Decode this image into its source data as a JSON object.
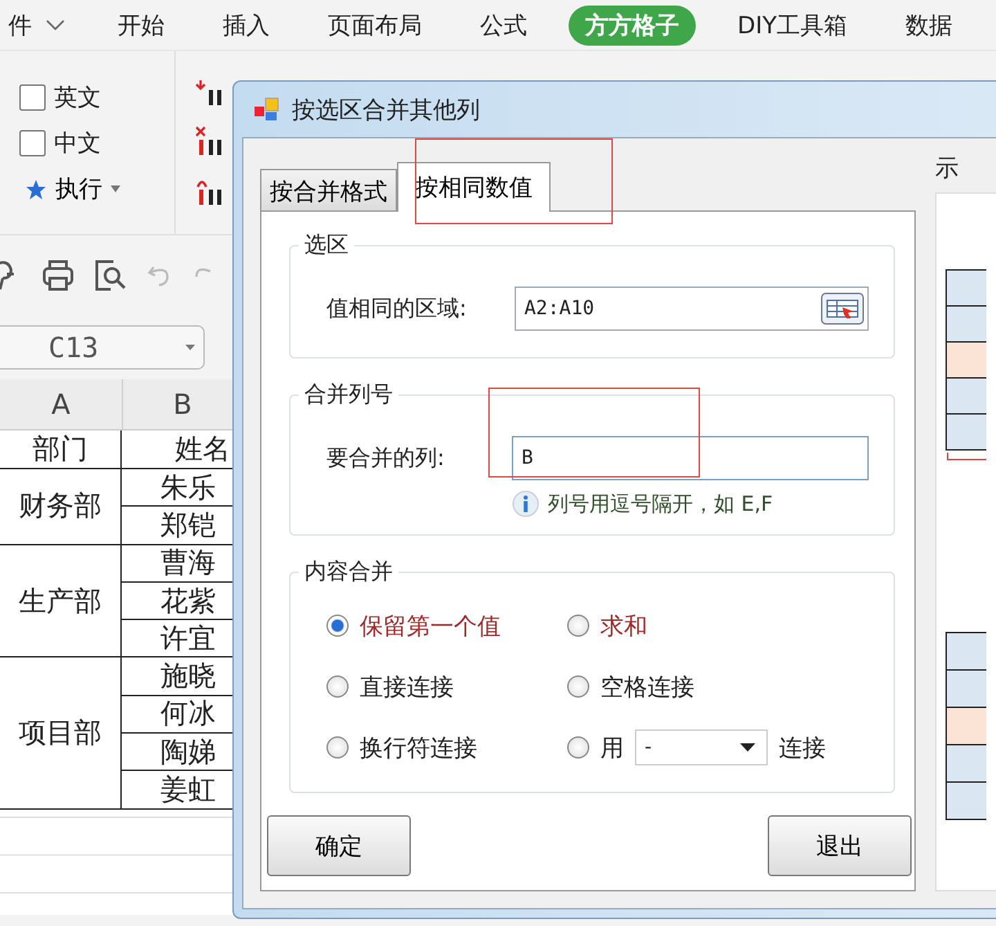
{
  "ribbon_tabs": [
    {
      "label": "件",
      "kind": "menu"
    },
    {
      "label": "开始",
      "kind": "tab",
      "selected": false
    },
    {
      "label": "插入",
      "kind": "tab",
      "selected": false
    },
    {
      "label": "页面布局",
      "kind": "tab",
      "selected": false
    },
    {
      "label": "公式",
      "kind": "tab",
      "selected": false
    },
    {
      "label": "方方格子",
      "kind": "tab",
      "selected": true
    },
    {
      "label": "DIY工具箱",
      "kind": "tab",
      "selected": false
    },
    {
      "label": "数据",
      "kind": "tab",
      "selected": false
    }
  ],
  "ribbon": {
    "checkboxes": [
      {
        "label": "英文",
        "checked": false
      },
      {
        "label": "中文",
        "checked": false
      }
    ],
    "run_button": {
      "label": "执行"
    }
  },
  "name_box": {
    "value": "C13"
  },
  "sheet": {
    "columns": [
      "A",
      "B"
    ],
    "header": [
      "部门",
      "姓名"
    ],
    "groups": [
      {
        "department": "财务部",
        "names": [
          "朱乐",
          "郑铠"
        ]
      },
      {
        "department": "生产部",
        "names": [
          "曹海",
          "花紫",
          "许宜"
        ]
      },
      {
        "department": "项目部",
        "names": [
          "施晓",
          "何冰",
          "陶娣",
          "姜虹"
        ]
      }
    ]
  },
  "dialog": {
    "title": "按选区合并其他列",
    "tabs": [
      {
        "label": "按合并格式",
        "selected": false
      },
      {
        "label": "按相同数值",
        "selected": true
      }
    ],
    "range_group": {
      "title": "选区",
      "label": "值相同的区域:",
      "value": "A2:A10"
    },
    "column_group": {
      "title": "合并列号",
      "label": "要合并的列:",
      "value": "B",
      "hint": "列号用逗号隔开，如 E,F"
    },
    "content_group": {
      "title": "内容合并",
      "options": [
        {
          "label": "保留第一个值",
          "selected": true,
          "highlighted": true
        },
        {
          "label": "求和",
          "selected": false,
          "highlighted": true
        },
        {
          "label": "直接连接",
          "selected": false,
          "highlighted": false
        },
        {
          "label": "空格连接",
          "selected": false,
          "highlighted": false
        },
        {
          "label": "换行符连接",
          "selected": false,
          "highlighted": false
        },
        {
          "label": "用",
          "selected": false,
          "highlighted": false,
          "separator": "-",
          "suffix": "连接"
        }
      ]
    },
    "buttons": [
      "确定",
      "退出"
    ],
    "example_label": "示"
  }
}
